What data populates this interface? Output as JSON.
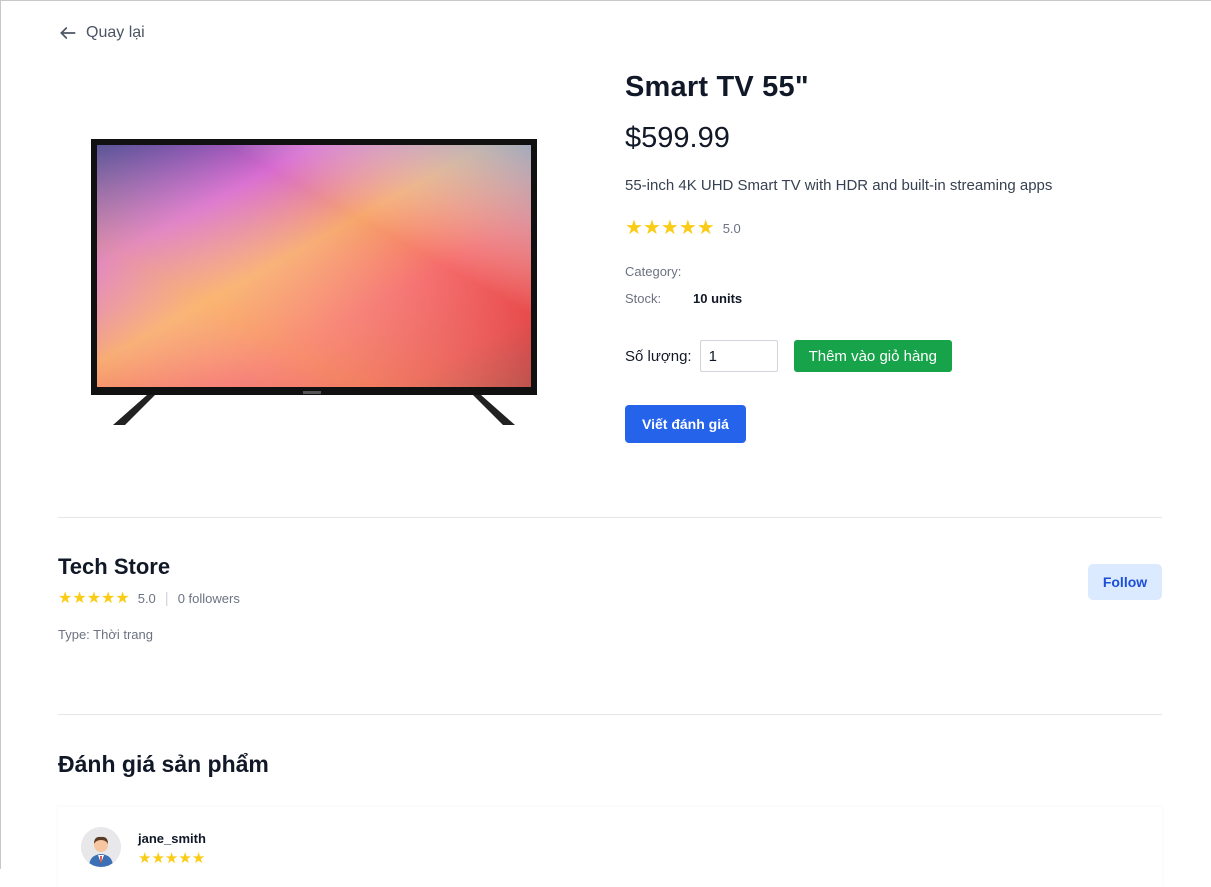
{
  "nav": {
    "back_label": "Quay lại"
  },
  "product": {
    "title": "Smart TV 55\"",
    "price": "$599.99",
    "description": "55-inch 4K UHD Smart TV with HDR and built-in streaming apps",
    "rating": 5.0,
    "rating_text": "5.0",
    "category_label": "Category:",
    "category_value": "",
    "stock_label": "Stock:",
    "stock_value": "10 units",
    "quantity_label": "Số lượng:",
    "quantity_value": "1",
    "add_to_cart_label": "Thêm vào giỏ hàng",
    "write_review_label": "Viết đánh giá"
  },
  "store": {
    "name": "Tech Store",
    "rating": 5.0,
    "rating_text": "5.0",
    "followers_text": "0 followers",
    "type_text": "Type: Thời trang",
    "follow_label": "Follow"
  },
  "reviews": {
    "heading": "Đánh giá sản phẩm",
    "items": [
      {
        "username": "jane_smith",
        "rating": 5
      }
    ]
  },
  "colors": {
    "star": "#facc15",
    "add_to_cart": "#16a34a",
    "write_review": "#2563eb",
    "follow_bg": "#dbeafe",
    "follow_text": "#1d4ed8"
  },
  "icons": {
    "back": "arrow-left-icon",
    "star": "star-icon",
    "avatar": "user-avatar-icon"
  }
}
